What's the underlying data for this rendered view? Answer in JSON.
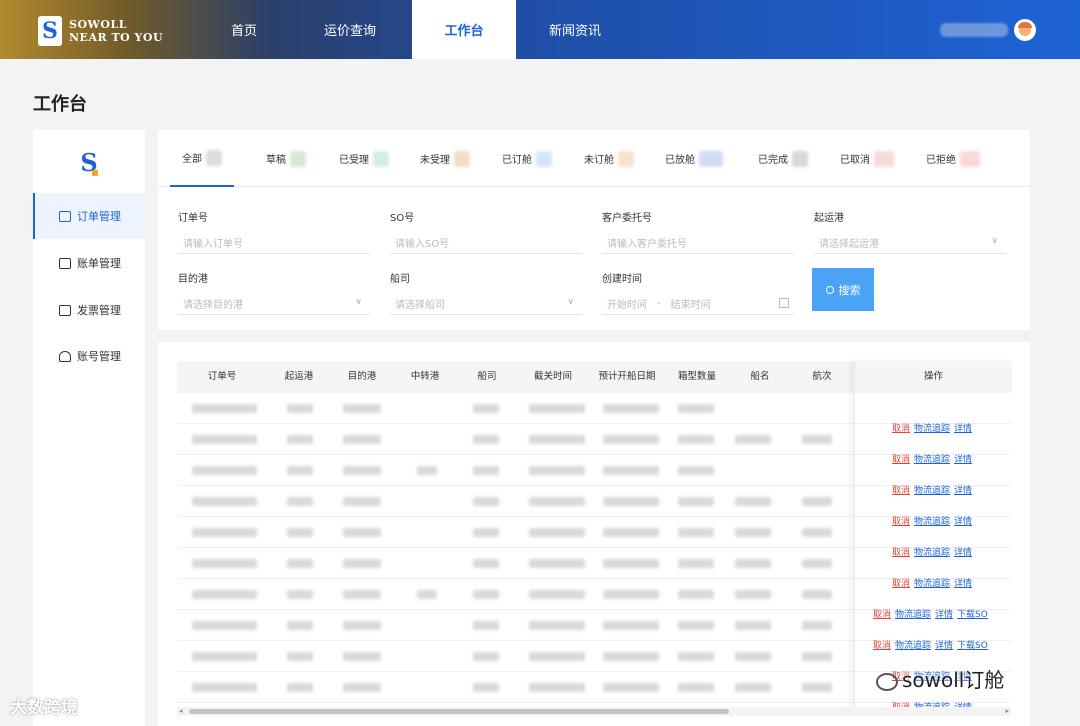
{
  "header": {
    "logo_line1": "SOWOLL",
    "logo_line2": "NEAR TO YOU",
    "logo_mark": "S",
    "nav": [
      {
        "label": "首页",
        "active": false
      },
      {
        "label": "运价查询",
        "active": false
      },
      {
        "label": "工作台",
        "active": true
      },
      {
        "label": "新闻资讯",
        "active": false
      }
    ]
  },
  "page_title": "工作台",
  "sidebar": {
    "logo_mark": "S",
    "items": [
      {
        "label": "订单管理",
        "icon": "order-icon",
        "active": true
      },
      {
        "label": "账单管理",
        "icon": "wallet-icon",
        "active": false
      },
      {
        "label": "发票管理",
        "icon": "ticket-icon",
        "active": false
      },
      {
        "label": "账号管理",
        "icon": "person-icon",
        "active": false
      }
    ]
  },
  "tabs": [
    {
      "label": "全部",
      "active": true
    },
    {
      "label": "草稿",
      "active": false
    },
    {
      "label": "已受理",
      "active": false
    },
    {
      "label": "未受理",
      "active": false
    },
    {
      "label": "已订舱",
      "active": false
    },
    {
      "label": "未订舱",
      "active": false
    },
    {
      "label": "已放舱",
      "active": false
    },
    {
      "label": "已完成",
      "active": false
    },
    {
      "label": "已取消",
      "active": false
    },
    {
      "label": "已拒绝",
      "active": false
    }
  ],
  "filters": {
    "order_no": {
      "label": "订单号",
      "placeholder": "请输入订单号"
    },
    "so_no": {
      "label": "SO号",
      "placeholder": "请输入SO号"
    },
    "client_ref": {
      "label": "客户委托号",
      "placeholder": "请输入客户委托号"
    },
    "pol": {
      "label": "起运港",
      "placeholder": "请选择起运港"
    },
    "pod": {
      "label": "目的港",
      "placeholder": "请选择目的港"
    },
    "carrier": {
      "label": "船司",
      "placeholder": "请选择船司"
    },
    "created": {
      "label": "创建时间",
      "start": "开始时间",
      "end": "结束时间"
    },
    "search_label": "搜索"
  },
  "table": {
    "columns": [
      "订单号",
      "起运港",
      "目的港",
      "中转港",
      "船司",
      "截关时间",
      "预计开船日期",
      "箱型数量",
      "船名",
      "航次"
    ],
    "ops_header": "操作",
    "rows": [
      {
        "ops": [
          "取消",
          "物流追踪",
          "详情"
        ]
      },
      {
        "ops": [
          "取消",
          "物流追踪",
          "详情"
        ]
      },
      {
        "ops": [
          "取消",
          "物流追踪",
          "详情"
        ]
      },
      {
        "ops": [
          "取消",
          "物流追踪",
          "详情"
        ]
      },
      {
        "ops": [
          "取消",
          "物流追踪",
          "详情"
        ]
      },
      {
        "ops": [
          "取消",
          "物流追踪",
          "详情"
        ]
      },
      {
        "ops": [
          "取消",
          "物流追踪",
          "详情",
          "下载SO"
        ]
      },
      {
        "ops": [
          "取消",
          "物流追踪",
          "详情",
          "下载SO"
        ]
      },
      {
        "ops": [
          "取消",
          "物流追踪",
          "详情"
        ]
      },
      {
        "ops": [
          "取消",
          "物流追踪",
          "详情"
        ]
      }
    ]
  },
  "watermarks": {
    "left": "大数跨境",
    "right": "sowoll订舱"
  },
  "colors": {
    "primary": "#1e63d6",
    "search_button": "#4aa3f5",
    "cancel": "#e0463b"
  }
}
